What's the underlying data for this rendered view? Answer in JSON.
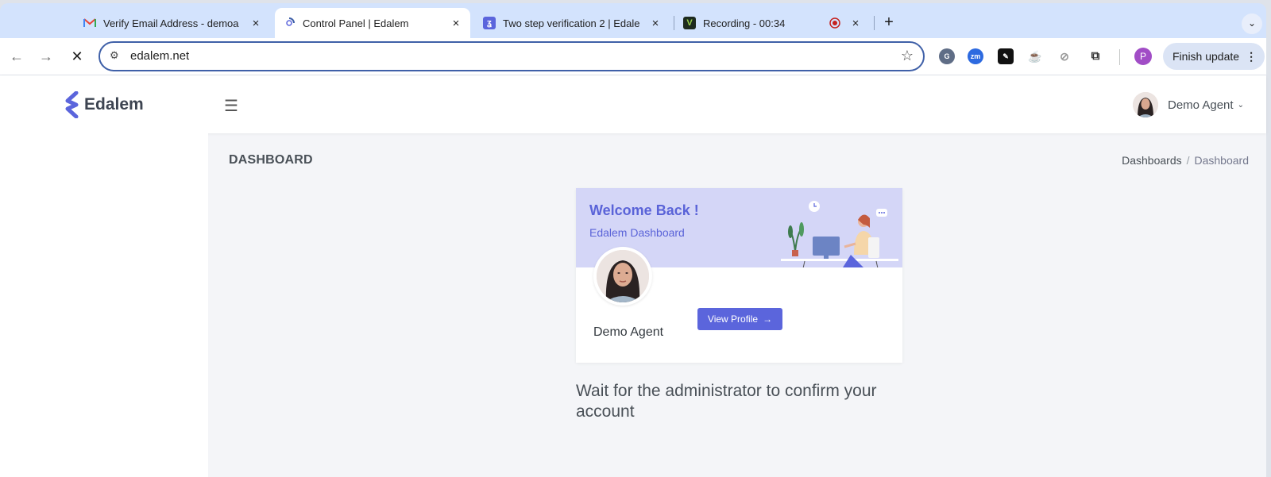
{
  "browser": {
    "tabs": [
      {
        "title": "Verify Email Address - demoa",
        "icon": "gmail-icon",
        "active": false
      },
      {
        "title": "Control Panel | Edalem",
        "icon": "loading-icon",
        "active": true
      },
      {
        "title": "Two step verification 2 | Edale",
        "icon": "edalem-favicon",
        "active": false
      },
      {
        "title": "Recording - 00:34",
        "icon": "vidyard-icon",
        "active": false
      }
    ],
    "new_tab_label": "+",
    "url": "edalem.net",
    "finish_update_label": "Finish update",
    "profile_initial": "P",
    "colors": {
      "tabbar": "#d3e3fd",
      "omnibox_border": "#3f60a8",
      "profile": "#a14dc6"
    }
  },
  "header": {
    "logo_text": "Edalem",
    "user_name": "Demo Agent"
  },
  "main": {
    "page_title": "DASHBOARD",
    "breadcrumb": [
      "Dashboards",
      "Dashboard"
    ],
    "welcome_card": {
      "title": "Welcome Back !",
      "subtitle": "Edalem Dashboard",
      "name": "Demo Agent",
      "view_profile_label": "View Profile",
      "accent_color": "#5b65dc"
    },
    "message": "Wait for the administrator to confirm your account"
  }
}
